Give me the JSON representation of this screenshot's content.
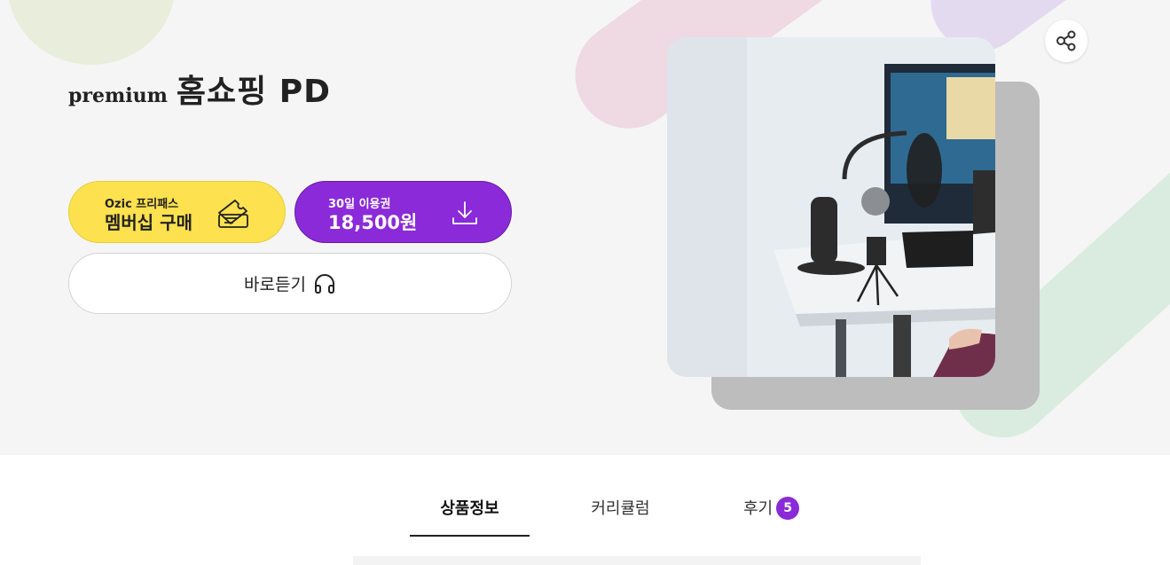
{
  "product": {
    "tag": "premium",
    "name": "홈쇼핑 PD"
  },
  "buttons": {
    "membership_small": "Ozic 프리패스",
    "membership_big": "멤버십 구매",
    "pass_small": "30일 이용권",
    "pass_price": "18,500원",
    "listen": "바로듣기"
  },
  "tabs": {
    "info": "상품정보",
    "curriculum": "커리큘럼",
    "review": "후기",
    "review_count": "5"
  },
  "colors": {
    "accent_purple": "#8b2ad8",
    "accent_yellow": "#fde14e"
  },
  "icons": {
    "share": "share-icon",
    "ticket": "ticket-icon",
    "download": "download-icon",
    "headphones": "headphones-icon"
  }
}
